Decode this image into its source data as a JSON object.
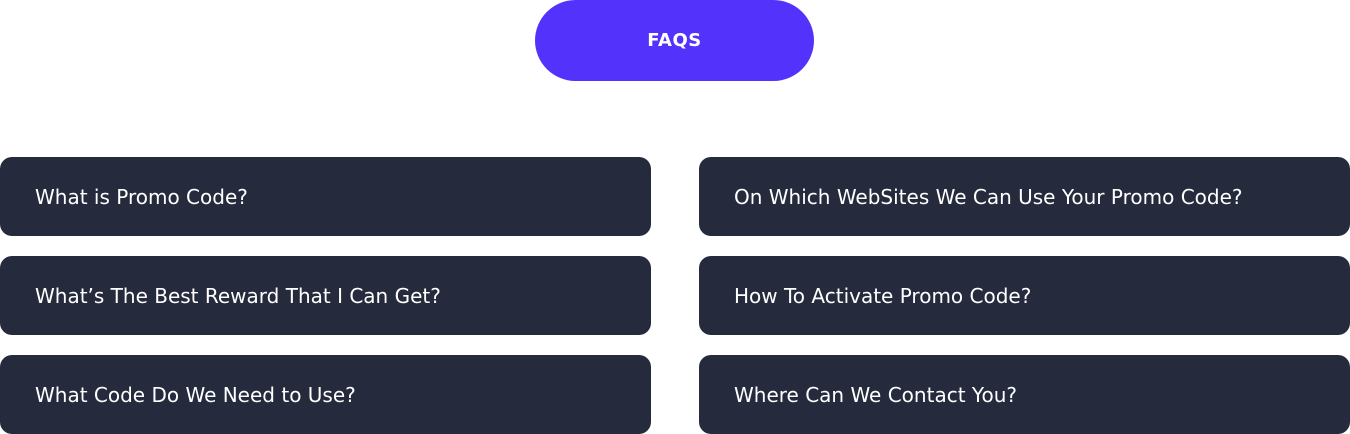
{
  "header": {
    "faqs_label": "FAQS"
  },
  "faq": {
    "items": [
      {
        "question": "What is Promo Code?"
      },
      {
        "question": "On Which WebSites We Can Use Your Promo Code?"
      },
      {
        "question": "What’s The Best Reward That I Can Get?"
      },
      {
        "question": "How To Activate Promo Code?"
      },
      {
        "question": "What Code Do We Need to Use?"
      },
      {
        "question": "Where Can We Contact You?"
      }
    ]
  },
  "colors": {
    "accent": "#5333fc",
    "card_background": "#252a3d",
    "text_on_dark": "#ffffff",
    "page_background": "#ffffff"
  }
}
